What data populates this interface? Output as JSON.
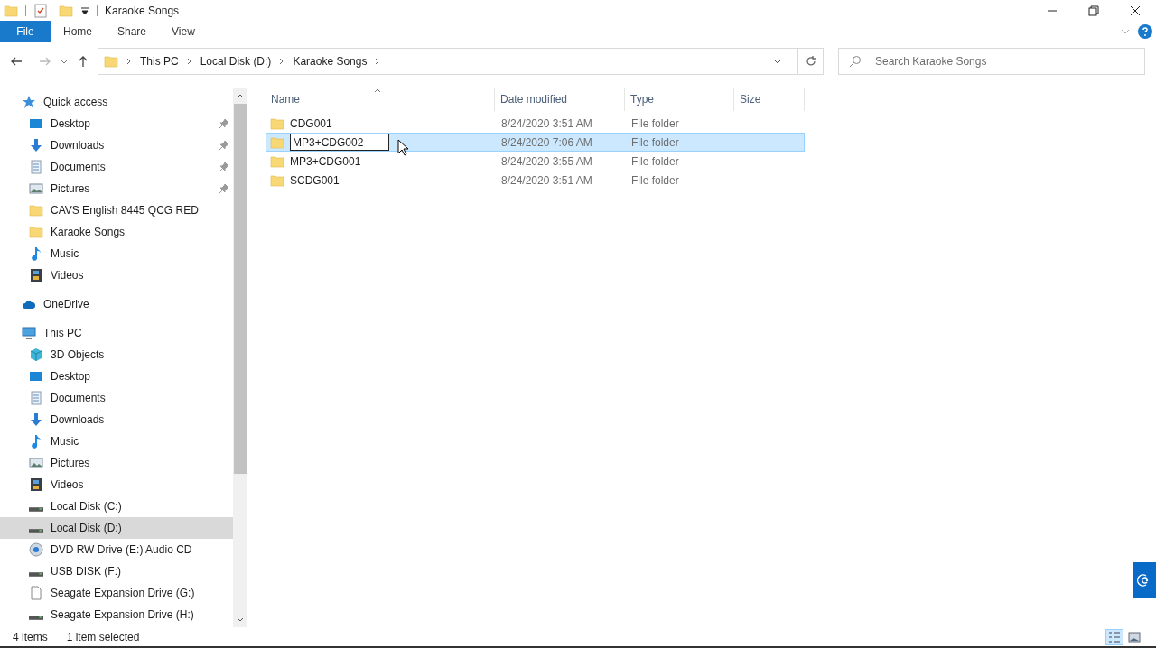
{
  "window": {
    "title": "Karaoke Songs"
  },
  "ribbon_tabs": [
    {
      "label": "File",
      "selected": true
    },
    {
      "label": "Home",
      "selected": false
    },
    {
      "label": "Share",
      "selected": false
    },
    {
      "label": "View",
      "selected": false
    }
  ],
  "breadcrumb": [
    "This PC",
    "Local Disk (D:)",
    "Karaoke Songs"
  ],
  "search": {
    "placeholder": "Search Karaoke Songs"
  },
  "sidebar": {
    "items": [
      {
        "label": "Quick access",
        "kind": "star",
        "selected": false,
        "children": [
          {
            "label": "Desktop",
            "kind": "desktop",
            "pinned": true,
            "selected": false
          },
          {
            "label": "Downloads",
            "kind": "download",
            "pinned": true,
            "selected": false
          },
          {
            "label": "Documents",
            "kind": "document",
            "pinned": true,
            "selected": false
          },
          {
            "label": "Pictures",
            "kind": "pictures",
            "pinned": true,
            "selected": false
          },
          {
            "label": "CAVS English 8445 QCG RED",
            "kind": "folder",
            "pinned": false,
            "selected": false
          },
          {
            "label": "Karaoke Songs",
            "kind": "folder",
            "pinned": false,
            "selected": false
          },
          {
            "label": "Music",
            "kind": "music",
            "pinned": false,
            "selected": false
          },
          {
            "label": "Videos",
            "kind": "video",
            "pinned": false,
            "selected": false
          }
        ]
      },
      {
        "label": "OneDrive",
        "kind": "cloud",
        "selected": false
      },
      {
        "label": "This PC",
        "kind": "pc",
        "selected": false,
        "children": [
          {
            "label": "3D Objects",
            "kind": "cube",
            "selected": false
          },
          {
            "label": "Desktop",
            "kind": "desktop",
            "selected": false
          },
          {
            "label": "Documents",
            "kind": "document",
            "selected": false
          },
          {
            "label": "Downloads",
            "kind": "download",
            "selected": false
          },
          {
            "label": "Music",
            "kind": "music",
            "selected": false
          },
          {
            "label": "Pictures",
            "kind": "pictures",
            "selected": false
          },
          {
            "label": "Videos",
            "kind": "video",
            "selected": false
          },
          {
            "label": "Local Disk (C:)",
            "kind": "drive",
            "selected": false
          },
          {
            "label": "Local Disk (D:)",
            "kind": "drive",
            "selected": true
          },
          {
            "label": "DVD RW Drive (E:) Audio CD",
            "kind": "dvd",
            "selected": false
          },
          {
            "label": "USB DISK (F:)",
            "kind": "drive",
            "selected": false
          },
          {
            "label": "Seagate Expansion Drive (G:)",
            "kind": "file",
            "selected": false
          },
          {
            "label": "Seagate Expansion Drive (H:)",
            "kind": "drive",
            "selected": false
          }
        ]
      }
    ]
  },
  "table": {
    "columns": [
      "Name",
      "Date modified",
      "Type",
      "Size"
    ],
    "rows": [
      {
        "name": "CDG001",
        "date": "8/24/2020 3:51 AM",
        "type": "File folder",
        "selected": false,
        "renaming": false
      },
      {
        "name": "MP3+CDG002",
        "date": "8/24/2020 7:06 AM",
        "type": "File folder",
        "selected": true,
        "renaming": true
      },
      {
        "name": "MP3+CDG001",
        "date": "8/24/2020 3:55 AM",
        "type": "File folder",
        "selected": false,
        "renaming": false
      },
      {
        "name": "SCDG001",
        "date": "8/24/2020 3:51 AM",
        "type": "File folder",
        "selected": false,
        "renaming": false
      }
    ]
  },
  "status_bar": {
    "count": "4 items",
    "selection": "1 item selected"
  },
  "views": [
    {
      "kind": "details",
      "selected": true
    },
    {
      "kind": "tiles",
      "selected": false
    }
  ]
}
